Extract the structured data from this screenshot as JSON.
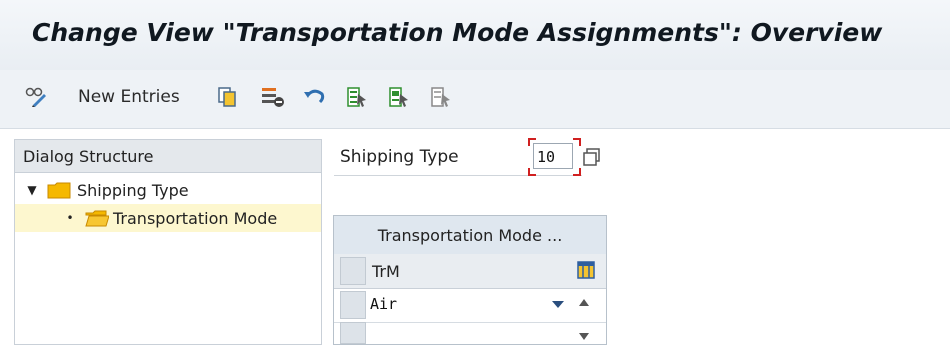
{
  "title": "Change View \"Transportation Mode Assignments\": Overview",
  "toolbar": {
    "new_entries_label": "New Entries",
    "icons": [
      "glasses-icon",
      "copy-icon",
      "delete-icon",
      "undo-icon",
      "select-all-icon",
      "select-block-icon",
      "deselect-all-icon"
    ]
  },
  "dialog_structure": {
    "header": "Dialog Structure",
    "items": [
      {
        "label": "Shipping Type",
        "marker": "▼",
        "selected": false
      },
      {
        "label": "Transportation Mode",
        "marker": "•",
        "selected": true
      }
    ]
  },
  "form": {
    "shipping_type_label": "Shipping Type",
    "shipping_type_value": "10"
  },
  "table": {
    "title": "Transportation Mode ...",
    "column_header": "TrM",
    "rows": [
      {
        "value": "Air"
      }
    ]
  },
  "colors": {
    "title_bg": "#eef2f6",
    "selected_row": "#fdf7cf",
    "folder": "#f5b800",
    "highlight_border": "#d02020"
  }
}
